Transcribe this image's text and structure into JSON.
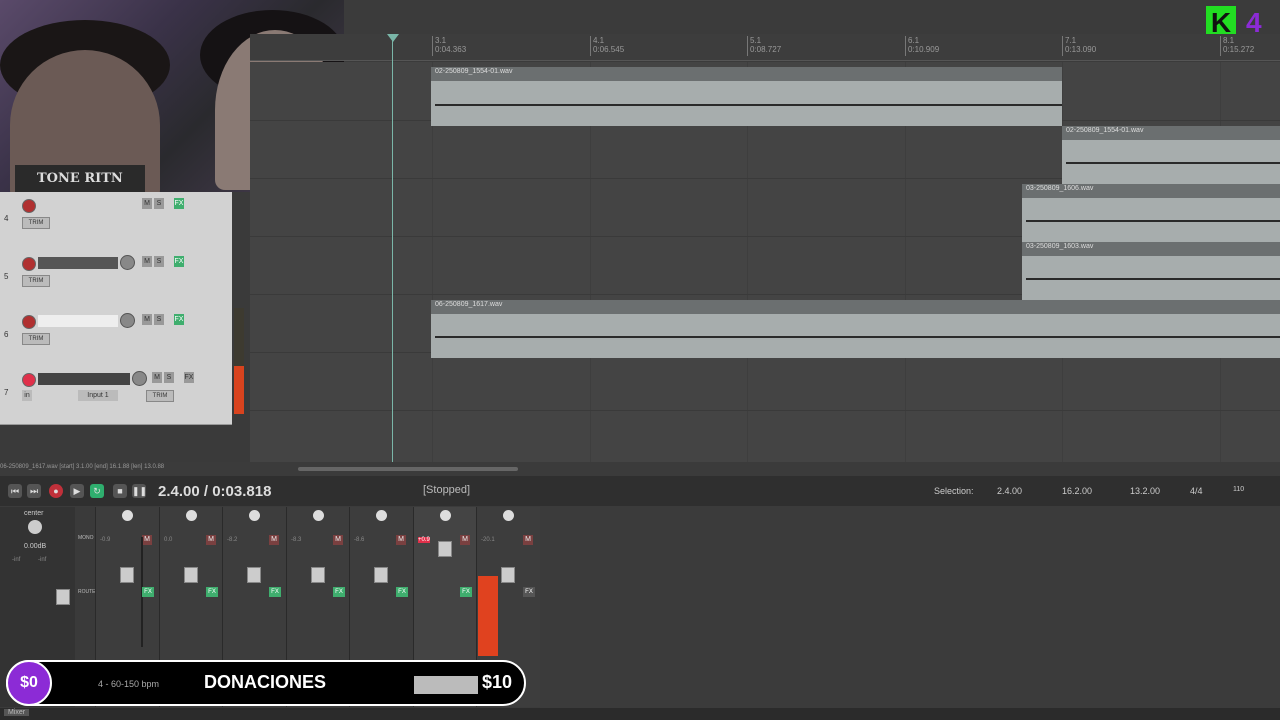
{
  "webcam": {
    "shirt_text": "TONE RITN"
  },
  "logo": {
    "letter": "K",
    "number": "4"
  },
  "ruler": {
    "marks": [
      {
        "bar": "3.1",
        "time": "0:04.363"
      },
      {
        "bar": "4.1",
        "time": "0:06.545"
      },
      {
        "bar": "5.1",
        "time": "0:08.727"
      },
      {
        "bar": "6.1",
        "time": "0:10.909"
      },
      {
        "bar": "7.1",
        "time": "0:13.090"
      },
      {
        "bar": "8.1",
        "time": "0:15.272"
      }
    ]
  },
  "items": [
    {
      "name": "02-250809_1554-01.wav"
    },
    {
      "name": "02-250809_1554-01.wav"
    },
    {
      "name": "03-250809_1606.wav"
    },
    {
      "name": "03-250809_1603.wav"
    },
    {
      "name": "06-250809_1617.wav"
    }
  ],
  "tracks": [
    {
      "num": "4",
      "trim": "TRIM"
    },
    {
      "num": "5",
      "trim": "TRIM"
    },
    {
      "num": "6",
      "trim": "TRIM"
    },
    {
      "num": "7",
      "trim": "TRIM",
      "input": "Input 1",
      "in_label": "in"
    }
  ],
  "status_line": "06-250809_1617.wav [start] 3.1.00 [end] 16.1.88 [len] 13.0.88",
  "transport": {
    "position": "2.4.00 / 0:03.818",
    "state": "[Stopped]",
    "selection_label": "Selection:",
    "sel_start": "2.4.00",
    "sel_end": "16.2.00",
    "sel_len": "13.2.00",
    "time_sig": "4/4",
    "bpm": "110"
  },
  "mixer": {
    "master_label": "center",
    "master_vol": "0.00dB",
    "master_left": "-inf",
    "master_right": "-inf",
    "buttons": [
      "MONO",
      "M",
      "S",
      "ROUTE",
      "FX",
      "TRIM"
    ],
    "strip_vols": [
      "-0.9",
      "0.0",
      "-8.2",
      "-8.3",
      "-8.6",
      "+0.9",
      "-20.1"
    ],
    "peak_label": "+0.9"
  },
  "donations": {
    "amount": "$0",
    "label": "DONACIONES",
    "goal": "$10",
    "track_info": "4 - 60-150 bpm"
  },
  "bottom": {
    "mixer_tab": "Mixer"
  }
}
